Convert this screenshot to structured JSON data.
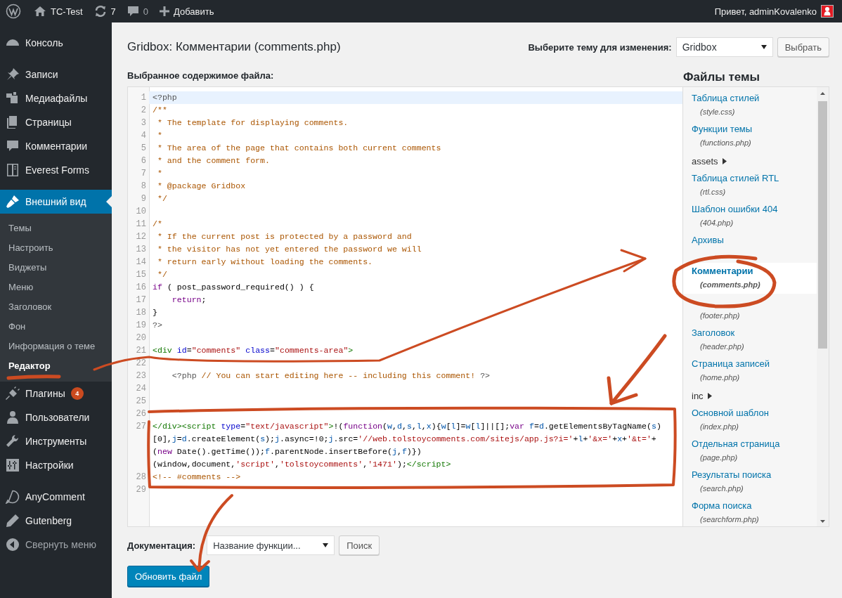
{
  "admin_bar": {
    "site": "TC-Test",
    "updates": "7",
    "comments": "0",
    "add": "Добавить",
    "greeting": "Привет, adminKovalenko"
  },
  "sidebar": {
    "groups": [
      {
        "items": [
          {
            "label": "Консоль",
            "kind": "dashboard",
            "selected": false
          }
        ]
      },
      {
        "items": [
          {
            "label": "Записи",
            "kind": "pin",
            "selected": false
          },
          {
            "label": "Медиафайлы",
            "kind": "media",
            "selected": false
          },
          {
            "label": "Страницы",
            "kind": "pages",
            "selected": false
          },
          {
            "label": "Комментарии",
            "kind": "comment",
            "selected": false
          },
          {
            "label": "Everest Forms",
            "kind": "forms",
            "selected": false
          }
        ]
      },
      {
        "items": [
          {
            "label": "Внешний вид",
            "kind": "brush",
            "selected": true,
            "children": [
              {
                "label": "Темы",
                "selected": false
              },
              {
                "label": "Настроить",
                "selected": false
              },
              {
                "label": "Виджеты",
                "selected": false
              },
              {
                "label": "Меню",
                "selected": false
              },
              {
                "label": "Заголовок",
                "selected": false
              },
              {
                "label": "Фон",
                "selected": false
              },
              {
                "label": "Информация о теме",
                "selected": false
              },
              {
                "label": "Редактор",
                "selected": true
              }
            ]
          },
          {
            "label": "Плагины",
            "kind": "plug",
            "selected": false,
            "badge": "4"
          },
          {
            "label": "Пользователи",
            "kind": "user",
            "selected": false
          },
          {
            "label": "Инструменты",
            "kind": "wrench",
            "selected": false
          },
          {
            "label": "Настройки",
            "kind": "sliders",
            "selected": false
          }
        ]
      },
      {
        "items": [
          {
            "label": "AnyComment",
            "kind": "bubble",
            "selected": false
          },
          {
            "label": "Gutenberg",
            "kind": "pencil",
            "selected": false
          },
          {
            "label": "Свернуть меню",
            "kind": "collapse",
            "selected": false
          }
        ]
      }
    ]
  },
  "page": {
    "title": "Gridbox: Комментарии (comments.php)",
    "theme_label": "Выберите тему для изменения:",
    "theme_value": "Gridbox",
    "select_button": "Выбрать",
    "content_label": "Выбранное содержимое файла:"
  },
  "editor": {
    "lines": [
      {
        "number": "1",
        "active": true,
        "rows": [
          {
            "tokens": [
              {
                "kind": "meta",
                "text": "<?php"
              }
            ]
          }
        ]
      },
      {
        "number": "2",
        "active": false,
        "rows": [
          {
            "tokens": [
              {
                "kind": "comment",
                "text": "/**"
              }
            ]
          }
        ]
      },
      {
        "number": "3",
        "active": false,
        "rows": [
          {
            "tokens": [
              {
                "kind": "comment",
                "text": " * The template for displaying comments."
              }
            ]
          }
        ]
      },
      {
        "number": "4",
        "active": false,
        "rows": [
          {
            "tokens": [
              {
                "kind": "comment",
                "text": " *"
              }
            ]
          }
        ]
      },
      {
        "number": "5",
        "active": false,
        "rows": [
          {
            "tokens": [
              {
                "kind": "comment",
                "text": " * The area of the page that contains both current comments"
              }
            ]
          }
        ]
      },
      {
        "number": "6",
        "active": false,
        "rows": [
          {
            "tokens": [
              {
                "kind": "comment",
                "text": " * and the comment form."
              }
            ]
          }
        ]
      },
      {
        "number": "7",
        "active": false,
        "rows": [
          {
            "tokens": [
              {
                "kind": "comment",
                "text": " *"
              }
            ]
          }
        ]
      },
      {
        "number": "8",
        "active": false,
        "rows": [
          {
            "tokens": [
              {
                "kind": "comment",
                "text": " * @package Gridbox"
              }
            ]
          }
        ]
      },
      {
        "number": "9",
        "active": false,
        "rows": [
          {
            "tokens": [
              {
                "kind": "comment",
                "text": " */"
              }
            ]
          }
        ]
      },
      {
        "number": "10",
        "active": false
      },
      {
        "number": "11",
        "active": false,
        "rows": [
          {
            "tokens": [
              {
                "kind": "comment",
                "text": "/*"
              }
            ]
          }
        ]
      },
      {
        "number": "12",
        "active": false,
        "rows": [
          {
            "tokens": [
              {
                "kind": "comment",
                "text": " * If the current post is protected by a password and"
              }
            ]
          }
        ]
      },
      {
        "number": "13",
        "active": false,
        "rows": [
          {
            "tokens": [
              {
                "kind": "comment",
                "text": " * the visitor has not yet entered the password we will"
              }
            ]
          }
        ]
      },
      {
        "number": "14",
        "active": false,
        "rows": [
          {
            "tokens": [
              {
                "kind": "comment",
                "text": " * return early without loading the comments."
              }
            ]
          }
        ]
      },
      {
        "number": "15",
        "active": false,
        "rows": [
          {
            "tokens": [
              {
                "kind": "comment",
                "text": " */"
              }
            ]
          }
        ]
      },
      {
        "number": "16",
        "active": false,
        "rows": [
          {
            "tokens": [
              {
                "kind": "keyword",
                "text": "if"
              },
              {
                "kind": "plain",
                "text": " ( post_password_required() ) {"
              }
            ]
          }
        ]
      },
      {
        "number": "17",
        "active": false,
        "rows": [
          {
            "tokens": [
              {
                "kind": "keyword",
                "text": "    return"
              },
              {
                "kind": "plain",
                "text": ";"
              }
            ]
          }
        ]
      },
      {
        "number": "18",
        "active": false,
        "rows": [
          {
            "tokens": [
              {
                "kind": "plain",
                "text": "}"
              }
            ]
          }
        ]
      },
      {
        "number": "19",
        "active": false,
        "rows": [
          {
            "tokens": [
              {
                "kind": "meta",
                "text": "?>"
              }
            ]
          }
        ]
      },
      {
        "number": "20",
        "active": false
      },
      {
        "number": "21",
        "active": false,
        "rows": [
          {
            "tokens": [
              {
                "kind": "tag",
                "text": "<div"
              },
              {
                "kind": "attr",
                "text": " id"
              },
              {
                "kind": "plain",
                "text": "="
              },
              {
                "kind": "string",
                "text": "\"comments\""
              },
              {
                "kind": "attr",
                "text": " class"
              },
              {
                "kind": "plain",
                "text": "="
              },
              {
                "kind": "string",
                "text": "\"comments-area\""
              },
              {
                "kind": "tag",
                "text": ">"
              }
            ]
          }
        ]
      },
      {
        "number": "22",
        "active": false
      },
      {
        "number": "23",
        "active": false,
        "rows": [
          {
            "tokens": [
              {
                "kind": "meta",
                "text": "    <?php"
              },
              {
                "kind": "comment",
                "text": " // You can start editing here -- including this comment! "
              },
              {
                "kind": "meta",
                "text": "?>"
              }
            ]
          }
        ]
      },
      {
        "number": "24",
        "active": false
      },
      {
        "number": "25",
        "active": false
      },
      {
        "number": "26",
        "active": false
      },
      {
        "number": "27",
        "active": false,
        "rows": [
          {
            "tokens": [
              {
                "kind": "tag",
                "text": "</div><script"
              },
              {
                "kind": "attr",
                "text": " type"
              },
              {
                "kind": "plain",
                "text": "="
              },
              {
                "kind": "string",
                "text": "\"text/javascript\""
              },
              {
                "kind": "tag",
                "text": ">"
              },
              {
                "kind": "plain",
                "text": "!("
              },
              {
                "kind": "keyword",
                "text": "function"
              },
              {
                "kind": "plain",
                "text": "("
              },
              {
                "kind": "variable",
                "text": "w"
              },
              {
                "kind": "plain",
                "text": ","
              },
              {
                "kind": "variable",
                "text": "d"
              },
              {
                "kind": "plain",
                "text": ","
              },
              {
                "kind": "variable",
                "text": "s"
              },
              {
                "kind": "plain",
                "text": ","
              },
              {
                "kind": "variable",
                "text": "l"
              },
              {
                "kind": "plain",
                "text": ","
              },
              {
                "kind": "variable",
                "text": "x"
              },
              {
                "kind": "plain",
                "text": "){"
              },
              {
                "kind": "variable",
                "text": "w"
              },
              {
                "kind": "plain",
                "text": "["
              },
              {
                "kind": "variable",
                "text": "l"
              },
              {
                "kind": "plain",
                "text": "]="
              },
              {
                "kind": "variable",
                "text": "w"
              },
              {
                "kind": "plain",
                "text": "["
              },
              {
                "kind": "variable",
                "text": "l"
              },
              {
                "kind": "plain",
                "text": "]||[];"
              },
              {
                "kind": "keyword",
                "text": "var"
              },
              {
                "kind": "variable",
                "text": " f"
              },
              {
                "kind": "plain",
                "text": "="
              },
              {
                "kind": "variable",
                "text": "d"
              },
              {
                "kind": "plain",
                "text": ".getElementsByTagName("
              },
              {
                "kind": "variable",
                "text": "s"
              },
              {
                "kind": "plain",
                "text": ")"
              }
            ]
          },
          {
            "tokens": [
              {
                "kind": "plain",
                "text": "[0],"
              },
              {
                "kind": "variable",
                "text": "j"
              },
              {
                "kind": "plain",
                "text": "="
              },
              {
                "kind": "variable",
                "text": "d"
              },
              {
                "kind": "plain",
                "text": ".createElement("
              },
              {
                "kind": "variable",
                "text": "s"
              },
              {
                "kind": "plain",
                "text": ");"
              },
              {
                "kind": "variable",
                "text": "j"
              },
              {
                "kind": "plain",
                "text": ".async=!0;"
              },
              {
                "kind": "variable",
                "text": "j"
              },
              {
                "kind": "plain",
                "text": ".src="
              },
              {
                "kind": "string",
                "text": "'//web.tolstoycomments.com/sitejs/app.js?i='"
              },
              {
                "kind": "plain",
                "text": "+"
              },
              {
                "kind": "variable",
                "text": "l"
              },
              {
                "kind": "plain",
                "text": "+"
              },
              {
                "kind": "string",
                "text": "'&x='"
              },
              {
                "kind": "plain",
                "text": "+"
              },
              {
                "kind": "variable",
                "text": "x"
              },
              {
                "kind": "plain",
                "text": "+"
              },
              {
                "kind": "string",
                "text": "'&t='"
              },
              {
                "kind": "plain",
                "text": "+"
              }
            ]
          },
          {
            "tokens": [
              {
                "kind": "plain",
                "text": "("
              },
              {
                "kind": "keyword",
                "text": "new"
              },
              {
                "kind": "plain",
                "text": " Date().getTime());"
              },
              {
                "kind": "variable",
                "text": "f"
              },
              {
                "kind": "plain",
                "text": ".parentNode.insertBefore("
              },
              {
                "kind": "variable",
                "text": "j"
              },
              {
                "kind": "plain",
                "text": ","
              },
              {
                "kind": "variable",
                "text": "f"
              },
              {
                "kind": "plain",
                "text": ")})"
              }
            ]
          },
          {
            "tokens": [
              {
                "kind": "plain",
                "text": "(window,document,"
              },
              {
                "kind": "string",
                "text": "'script'"
              },
              {
                "kind": "plain",
                "text": ","
              },
              {
                "kind": "string",
                "text": "'tolstoycomments'"
              },
              {
                "kind": "plain",
                "text": ","
              },
              {
                "kind": "string",
                "text": "'1471'"
              },
              {
                "kind": "plain",
                "text": ");"
              },
              {
                "kind": "tag",
                "text": "</script>"
              }
            ]
          }
        ]
      },
      {
        "number": "28",
        "active": false,
        "rows": [
          {
            "tokens": [
              {
                "kind": "comment",
                "text": "<!-- #comments -->"
              }
            ]
          }
        ]
      },
      {
        "number": "29",
        "active": false
      }
    ]
  },
  "theme_files": {
    "title": "Файлы темы",
    "items": [
      {
        "kind": "file",
        "label": "Таблица стилей",
        "file": "(style.css)",
        "selected": false
      },
      {
        "kind": "file",
        "label": "Функции темы",
        "file": "(functions.php)",
        "selected": false
      },
      {
        "kind": "folder",
        "label": "assets"
      },
      {
        "kind": "file",
        "label": "Таблица стилей RTL",
        "file": "(rtl.css)",
        "selected": false
      },
      {
        "kind": "file",
        "label": "Шаблон ошибки 404",
        "file": "(404.php)",
        "selected": false
      },
      {
        "kind": "file",
        "label": "Архивы",
        "selected": false
      },
      {
        "kind": "file",
        "label": "Комментарии",
        "file": "(comments.php)",
        "selected": true
      },
      {
        "kind": "file",
        "file": "(footer.php)",
        "selected": false
      },
      {
        "kind": "file",
        "label": "Заголовок",
        "file": "(header.php)",
        "selected": false
      },
      {
        "kind": "file",
        "label": "Страница записей",
        "file": "(home.php)",
        "selected": false
      },
      {
        "kind": "folder",
        "label": "inc"
      },
      {
        "kind": "file",
        "label": "Основной шаблон",
        "file": "(index.php)",
        "selected": false
      },
      {
        "kind": "file",
        "label": "Отдельная страница",
        "file": "(page.php)",
        "selected": false
      },
      {
        "kind": "file",
        "label": "Результаты поиска",
        "file": "(search.php)",
        "selected": false
      },
      {
        "kind": "file",
        "label": "Форма поиска",
        "file": "(searchform.php)",
        "selected": false
      }
    ]
  },
  "documentation": {
    "label": "Документация:",
    "placeholder": "Название функции...",
    "search_button": "Поиск"
  },
  "update_button": "Обновить файл"
}
